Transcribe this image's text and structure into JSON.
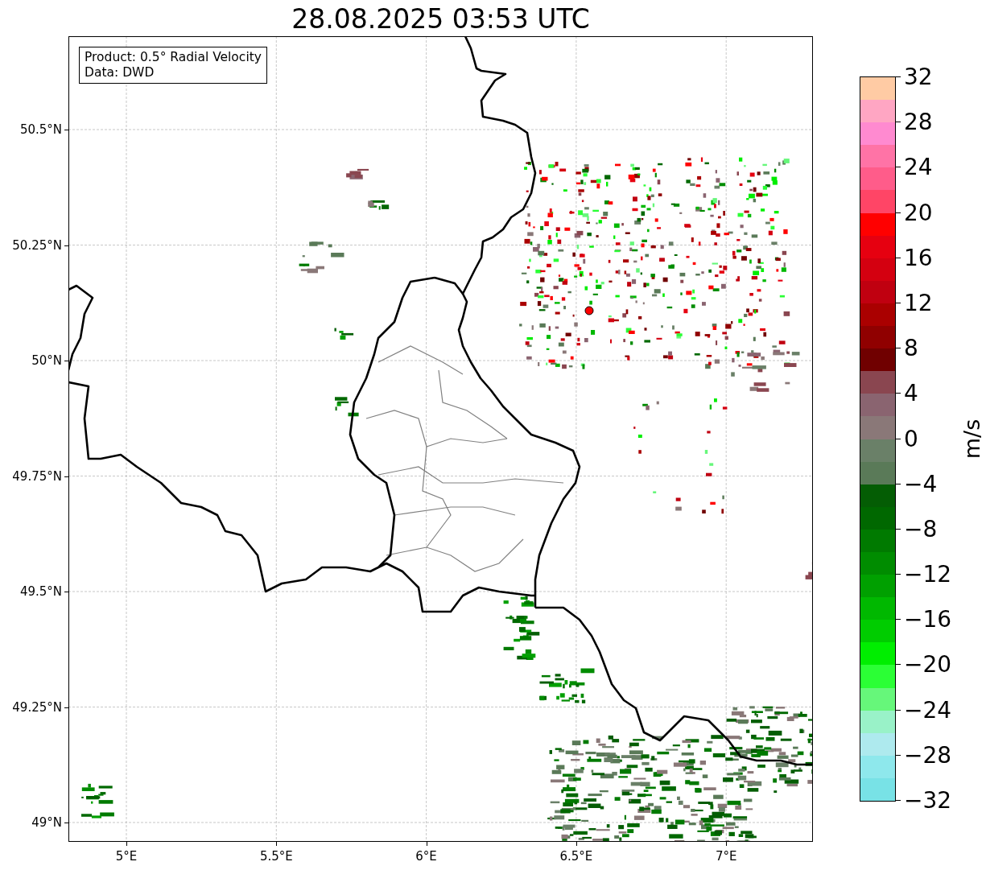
{
  "title": "28.08.2025 03:53 UTC",
  "info_box": [
    "Product: 0.5° Radial Velocity",
    "Data: DWD"
  ],
  "map": {
    "lat_labels": [
      "50.5°N",
      "50.25°N",
      "50°N",
      "49.75°N",
      "49.5°N",
      "49.25°N",
      "49°N"
    ],
    "lon_labels": [
      "5°E",
      "5.5°E",
      "6°E",
      "6.5°E",
      "7°E"
    ]
  },
  "colorbar": {
    "label": "m/s",
    "ticks": [
      "32",
      "28",
      "24",
      "20",
      "16",
      "12",
      "8",
      "4",
      "0",
      "−4",
      "−8",
      "−12",
      "−16",
      "−20",
      "−24",
      "−28",
      "−32"
    ],
    "bands": [
      {
        "color": "#ffcba4"
      },
      {
        "color": "#ffa6c3"
      },
      {
        "color": "#ff8ad0"
      },
      {
        "color": "#ff73a6"
      },
      {
        "color": "#ff5c8a"
      },
      {
        "color": "#ff4566"
      },
      {
        "color": "#ff0000"
      },
      {
        "color": "#e60010"
      },
      {
        "color": "#d40010"
      },
      {
        "color": "#c00010"
      },
      {
        "color": "#aa0000"
      },
      {
        "color": "#900000"
      },
      {
        "color": "#700000"
      },
      {
        "color": "#8a4650"
      },
      {
        "color": "#8a6470"
      },
      {
        "color": "#8a7878"
      },
      {
        "color": "#6a8068"
      },
      {
        "color": "#5a7a58"
      },
      {
        "color": "#045d04"
      },
      {
        "color": "#006800"
      },
      {
        "color": "#007a00"
      },
      {
        "color": "#008c00"
      },
      {
        "color": "#00a000"
      },
      {
        "color": "#00b800"
      },
      {
        "color": "#00cc00"
      },
      {
        "color": "#00ee00"
      },
      {
        "color": "#2bff35"
      },
      {
        "color": "#66f77a"
      },
      {
        "color": "#99f2c8"
      },
      {
        "color": "#aeeaee"
      },
      {
        "color": "#8ee8ec"
      },
      {
        "color": "#78e2e6"
      }
    ]
  }
}
